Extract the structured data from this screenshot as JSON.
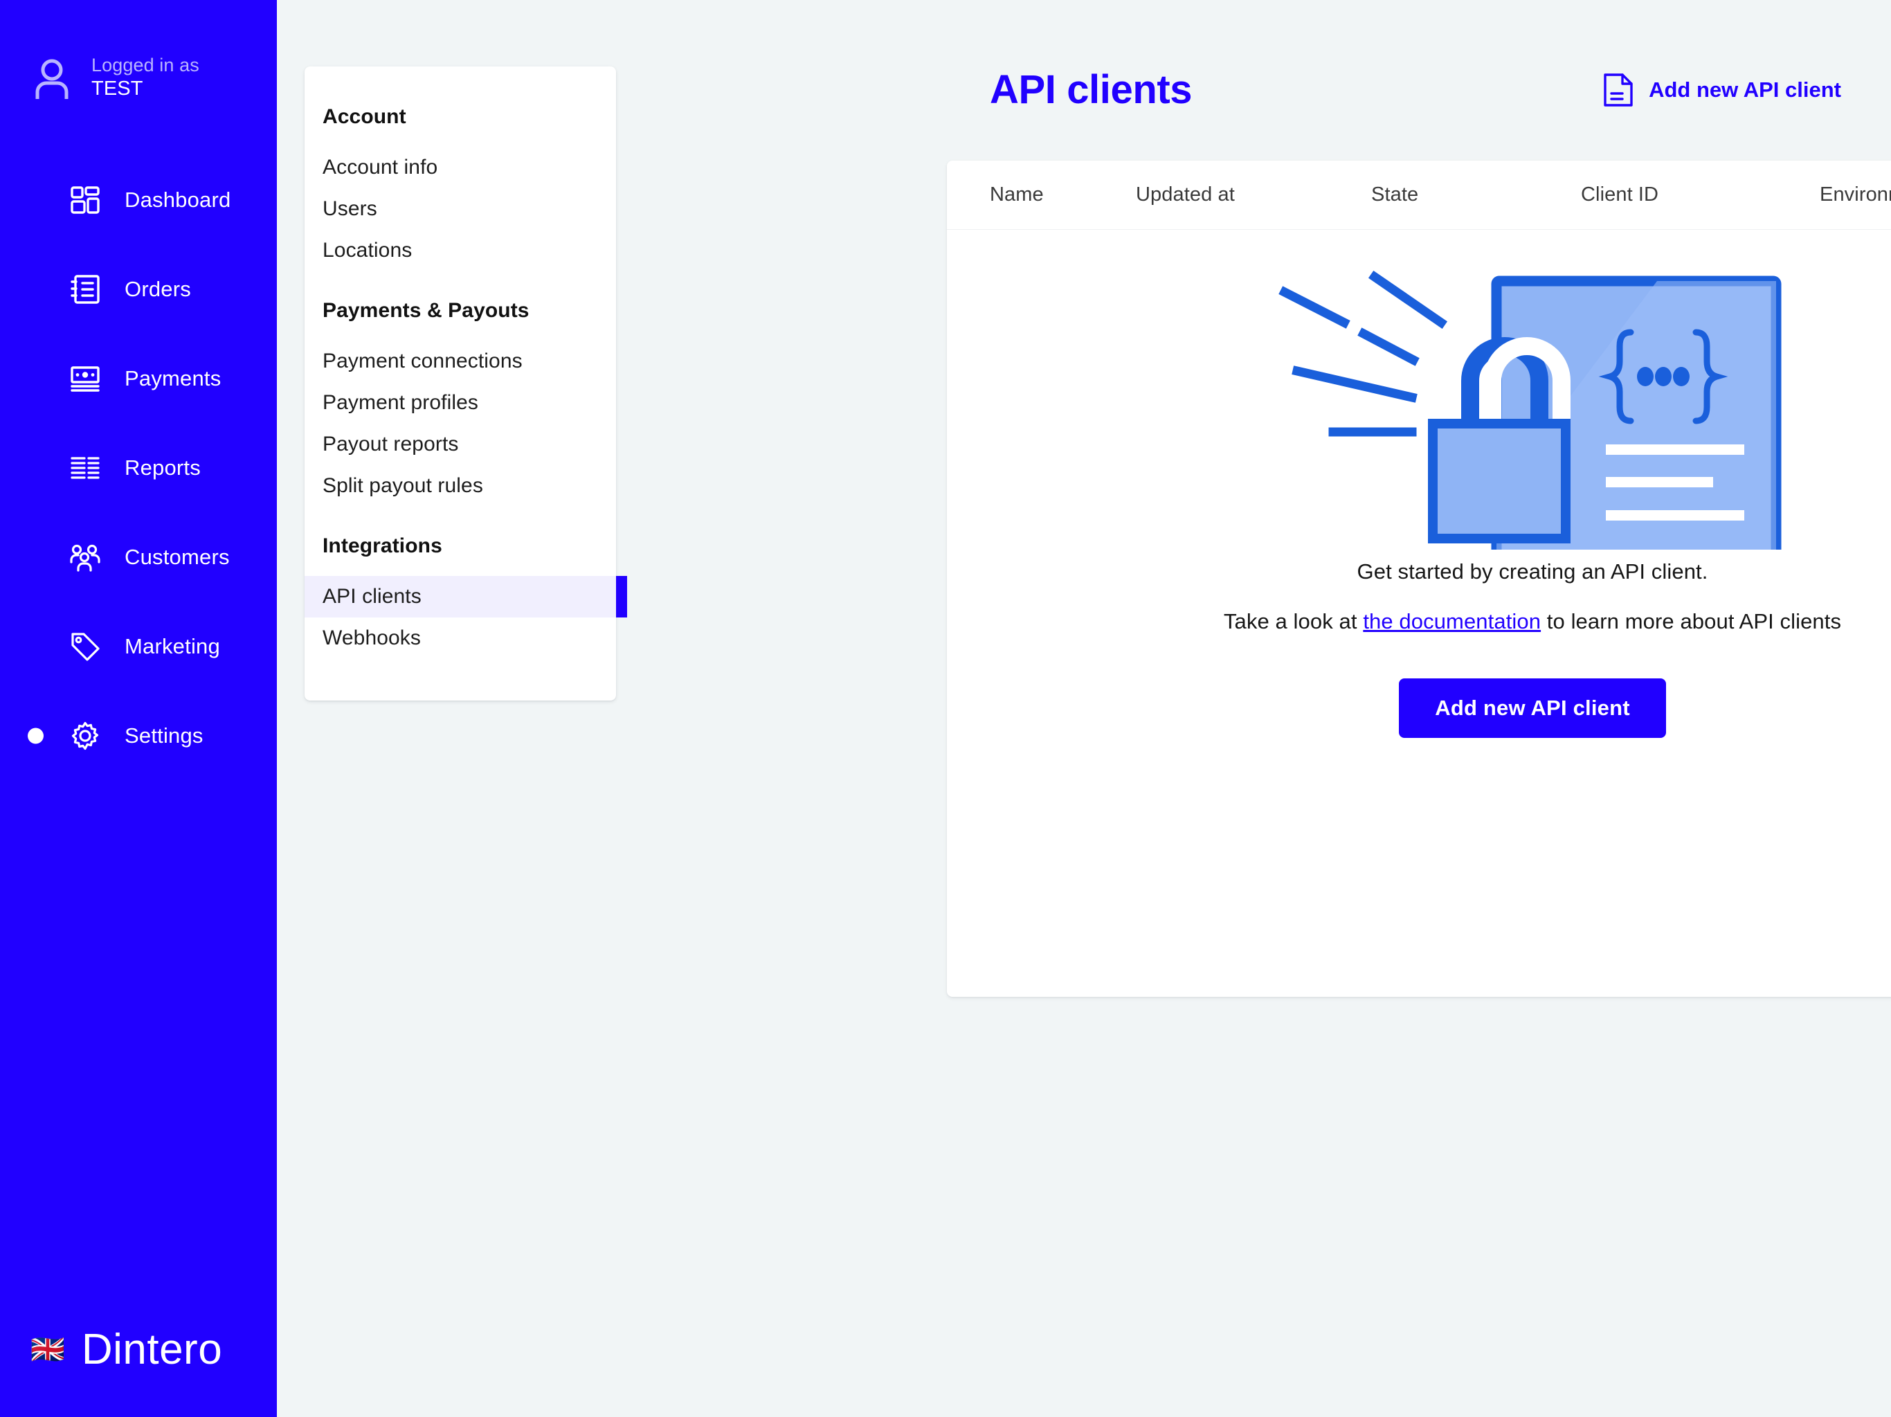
{
  "theme": {
    "sidebar_bg": "#2100ff",
    "accent": "#2100ff",
    "page_bg": "#f1f5f6",
    "active_row_bg": "#f1effe",
    "illustration_fill": "#8fb4f5",
    "illustration_stroke": "#1a5fdb"
  },
  "sidebar": {
    "user": {
      "label": "Logged in as",
      "name": "TEST",
      "avatar_icon": "user-avatar-icon"
    },
    "items": [
      {
        "label": "Dashboard",
        "icon": "dashboard-icon",
        "active": false
      },
      {
        "label": "Orders",
        "icon": "orders-book-icon",
        "active": false
      },
      {
        "label": "Payments",
        "icon": "banknote-icon",
        "active": false
      },
      {
        "label": "Reports",
        "icon": "reports-bars-icon",
        "active": false
      },
      {
        "label": "Customers",
        "icon": "customers-people-icon",
        "active": false
      },
      {
        "label": "Marketing",
        "icon": "marketing-tag-icon",
        "active": false
      },
      {
        "label": "Settings",
        "icon": "gear-icon",
        "active": true
      }
    ],
    "brand": {
      "flag": "🇬🇧",
      "name": "Dintero"
    }
  },
  "submenu": {
    "groups": [
      {
        "title": "Account",
        "items": [
          {
            "label": "Account info",
            "active": false
          },
          {
            "label": "Users",
            "active": false
          },
          {
            "label": "Locations",
            "active": false
          }
        ]
      },
      {
        "title": "Payments & Payouts",
        "items": [
          {
            "label": "Payment connections",
            "active": false
          },
          {
            "label": "Payment profiles",
            "active": false
          },
          {
            "label": "Payout reports",
            "active": false
          },
          {
            "label": "Split payout rules",
            "active": false
          }
        ]
      },
      {
        "title": "Integrations",
        "items": [
          {
            "label": "API clients",
            "active": true
          },
          {
            "label": "Webhooks",
            "active": false
          }
        ]
      }
    ]
  },
  "header": {
    "title": "API clients",
    "add_link_label": "Add new API client",
    "add_link_icon": "document-icon"
  },
  "table": {
    "columns": [
      "Name",
      "Updated at",
      "State",
      "Client ID",
      "Environment"
    ],
    "rows": []
  },
  "empty_state": {
    "illustration_icon": "api-lock-monitor-illustration",
    "heading": "Get started by creating an API client.",
    "sub_prefix": "Take a look at ",
    "sub_link": "the documentation",
    "sub_suffix": " to learn more about API clients",
    "button_label": "Add new API client"
  }
}
